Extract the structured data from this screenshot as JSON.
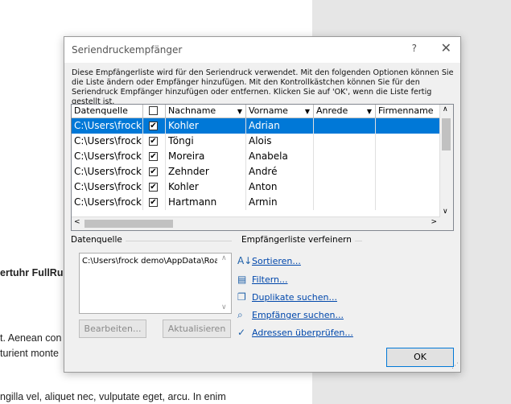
{
  "document": {
    "fragments": [
      "ertuhr FullRur",
      "t. Aenean con",
      "turient monte",
      "ngilla vel, aliquet nec, vulputate eget, arcu. In enim"
    ]
  },
  "dialog": {
    "title": "Seriendruckempfänger",
    "help": "?",
    "close": "✕",
    "description": "Diese Empfängerliste wird für den Seriendruck verwendet. Mit den folgenden Optionen können Sie die Liste ändern oder Empfänger hinzufügen. Mit den Kontrollkästchen können Sie für den Seriendruck Empfänger hinzufügen oder entfernen. Klicken Sie auf 'OK', wenn die Liste fertig gestellt ist.",
    "columns": [
      "Datenquelle",
      "",
      "Nachname",
      "Vorname",
      "Anrede",
      "Firmenname"
    ],
    "rows": [
      {
        "source": "C:\\Users\\frock...",
        "checked": "✔",
        "last": "Kohler",
        "first": "Adrian"
      },
      {
        "source": "C:\\Users\\frock...",
        "checked": "✔",
        "last": "Töngi",
        "first": "Alois"
      },
      {
        "source": "C:\\Users\\frock...",
        "checked": "✔",
        "last": "Moreira",
        "first": "Anabela"
      },
      {
        "source": "C:\\Users\\frock...",
        "checked": "✔",
        "last": "Zehnder",
        "first": "André"
      },
      {
        "source": "C:\\Users\\frock...",
        "checked": "✔",
        "last": "Kohler",
        "first": "Anton"
      },
      {
        "source": "C:\\Users\\frock...",
        "checked": "✔",
        "last": "Hartmann",
        "first": "Armin"
      }
    ],
    "datasource_label": "Datenquelle",
    "datasource_item": "C:\\Users\\frock demo\\AppData\\Roam",
    "edit_button": "Bearbeiten...",
    "refresh_button": "Aktualisieren",
    "refine_label": "Empfängerliste verfeinern",
    "links": [
      {
        "label": "Sortieren...",
        "icon": "sort-az-icon",
        "glyph": "A↓"
      },
      {
        "label": "Filtern...",
        "icon": "filter-icon",
        "glyph": "▤"
      },
      {
        "label": "Duplikate suchen...",
        "icon": "duplicates-icon",
        "glyph": "❐"
      },
      {
        "label": "Empfänger suchen...",
        "icon": "search-icon",
        "glyph": "⌕"
      },
      {
        "label": "Adressen überprüfen...",
        "icon": "validate-addresses-icon",
        "glyph": "✓"
      }
    ],
    "ok_button": "OK"
  }
}
